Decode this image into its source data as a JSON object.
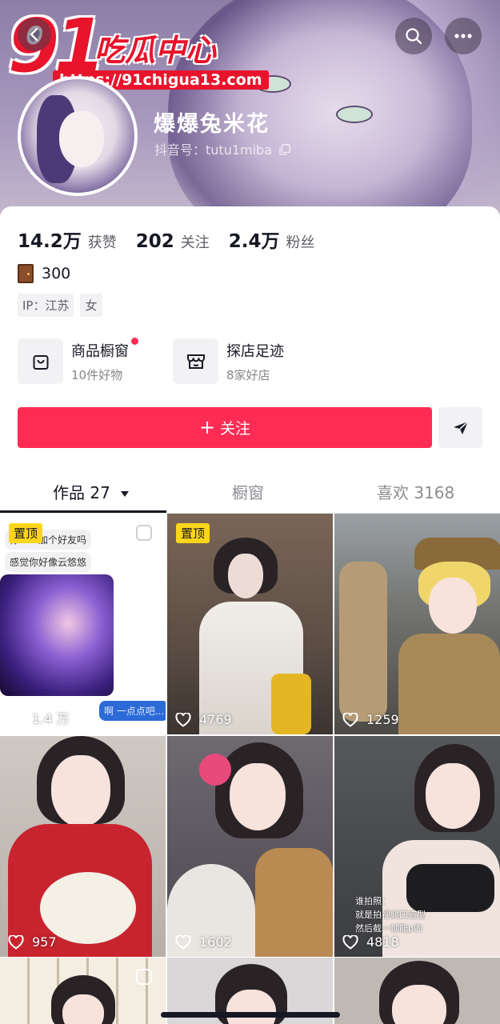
{
  "watermark": {
    "number": "91",
    "name": "吃瓜中心",
    "url": "https://91chigua13.com"
  },
  "header": {
    "back_icon": "back-icon",
    "search_icon": "search-icon",
    "more_icon": "more-icon"
  },
  "profile": {
    "nickname": "爆爆兔米花",
    "douyin_id": "抖音号：tutu1miba",
    "copy_icon": "copy-icon"
  },
  "stats": [
    {
      "value": "14.2万",
      "label": "获赞"
    },
    {
      "value": "202",
      "label": "关注"
    },
    {
      "value": "2.4万",
      "label": "粉丝"
    }
  ],
  "door": {
    "icon": "door-icon",
    "count": "300"
  },
  "tags": [
    "IP：江苏",
    "女"
  ],
  "shops": [
    {
      "title": "商品橱窗",
      "subtitle": "10件好物",
      "icon": "shopping-bag-icon",
      "has_dot": true
    },
    {
      "title": "探店足迹",
      "subtitle": "8家好店",
      "icon": "store-icon",
      "has_dot": false
    }
  ],
  "actions": {
    "follow_label": "关注",
    "follow_color": "#fe2c55",
    "share_icon": "send-icon"
  },
  "tabs": [
    {
      "label": "作品 27",
      "active": true
    },
    {
      "label": "橱窗",
      "active": false
    },
    {
      "label": "喜欢 3168",
      "active": false
    }
  ],
  "videos": [
    {
      "pinned": true,
      "pin_label": "置顶",
      "likes": "1.4 万",
      "bubbles": [
        "你……加个好友吗",
        "感觉你好像云悠悠",
        "啊 一点点吧..."
      ]
    },
    {
      "pinned": true,
      "pin_label": "置顶",
      "likes": "4769"
    },
    {
      "pinned": false,
      "likes": "1259"
    },
    {
      "pinned": false,
      "likes": "957"
    },
    {
      "pinned": false,
      "likes": "1602"
    },
    {
      "pinned": false,
      "likes": "4818",
      "caption": [
        "谁拍照：",
        "就是拍视频凹造型",
        "然后截一帧能p的"
      ]
    },
    {
      "pinned": false
    },
    {
      "pinned": false
    },
    {
      "pinned": false
    }
  ]
}
